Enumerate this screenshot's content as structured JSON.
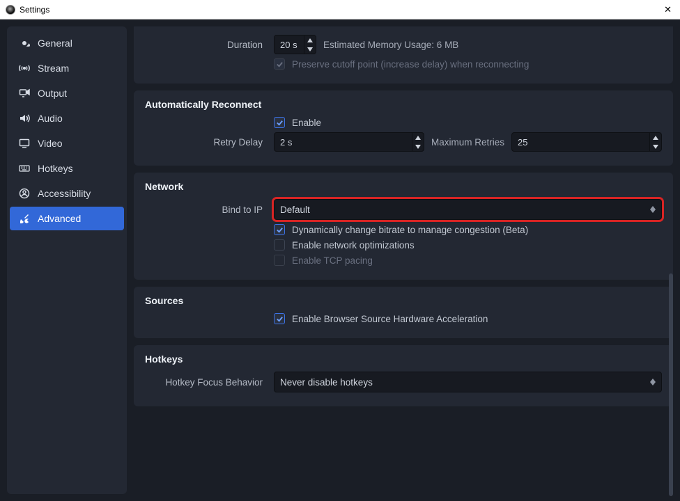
{
  "window": {
    "title": "Settings",
    "close_glyph": "✕"
  },
  "sidebar": {
    "items": [
      {
        "label": "General",
        "icon": "gear-icon",
        "selected": false
      },
      {
        "label": "Stream",
        "icon": "antenna-icon",
        "selected": false
      },
      {
        "label": "Output",
        "icon": "output-icon",
        "selected": false
      },
      {
        "label": "Audio",
        "icon": "speaker-icon",
        "selected": false
      },
      {
        "label": "Video",
        "icon": "monitor-icon",
        "selected": false
      },
      {
        "label": "Hotkeys",
        "icon": "keyboard-icon",
        "selected": false
      },
      {
        "label": "Accessibility",
        "icon": "person-icon",
        "selected": false
      },
      {
        "label": "Advanced",
        "icon": "tools-icon",
        "selected": true
      }
    ]
  },
  "delay_panel": {
    "duration_label": "Duration",
    "duration_value": "20 s",
    "memory_text": "Estimated Memory Usage: 6 MB",
    "preserve_label": "Preserve cutoff point (increase delay) when reconnecting",
    "preserve_checked": true,
    "preserve_disabled": true
  },
  "reconnect_panel": {
    "title": "Automatically Reconnect",
    "enable_label": "Enable",
    "enable_checked": true,
    "retry_label": "Retry Delay",
    "retry_value": "2 s",
    "max_label": "Maximum Retries",
    "max_value": "25"
  },
  "network_panel": {
    "title": "Network",
    "bind_label": "Bind to IP",
    "bind_value": "Default",
    "dyn_label": "Dynamically change bitrate to manage congestion (Beta)",
    "dyn_checked": true,
    "opt_label": "Enable network optimizations",
    "opt_checked": false,
    "tcp_label": "Enable TCP pacing",
    "tcp_checked": false,
    "tcp_disabled": true
  },
  "sources_panel": {
    "title": "Sources",
    "hwaccel_label": "Enable Browser Source Hardware Acceleration",
    "hwaccel_checked": true
  },
  "hotkeys_panel": {
    "title": "Hotkeys",
    "focus_label": "Hotkey Focus Behavior",
    "focus_value": "Never disable hotkeys"
  }
}
